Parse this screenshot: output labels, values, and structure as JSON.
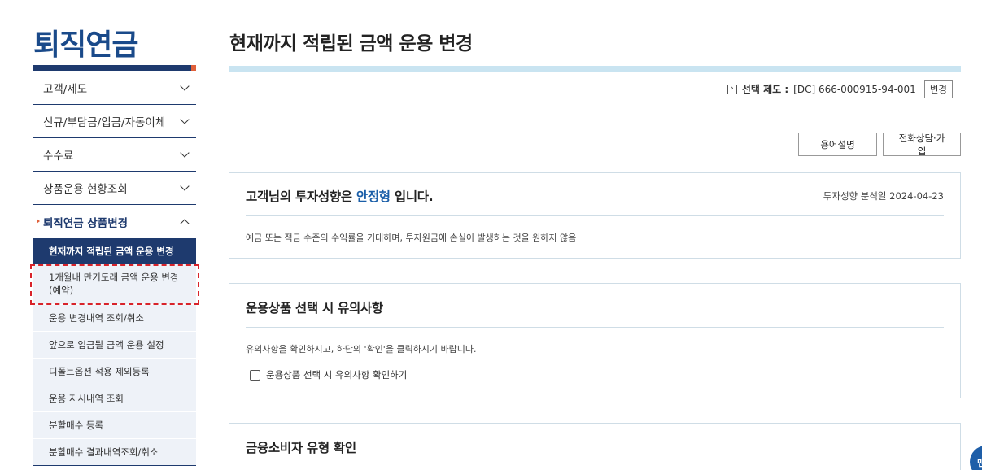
{
  "brand": "퇴직연금",
  "sidebar": {
    "items": [
      {
        "label": "고객/제도"
      },
      {
        "label": "신규/부담금/입금/자동이체"
      },
      {
        "label": "수수료"
      },
      {
        "label": "상품운용 현황조회"
      },
      {
        "label": "퇴직연금 상품변경"
      }
    ],
    "submenu": {
      "active": "현재까지 적립된 금액 운용 변경",
      "items": [
        {
          "label": "1개월내 만기도래 금액 운용 변경(예약)"
        },
        {
          "label": "운용 변경내역 조회/취소"
        },
        {
          "label": "앞으로 입금될 금액 운용 설정"
        },
        {
          "label": "디폴트옵션 적용 제외등록"
        },
        {
          "label": "운용 지시내역 조회"
        },
        {
          "label": "분할매수 등록"
        },
        {
          "label": "분할매수 결과내역조회/취소"
        }
      ]
    }
  },
  "main": {
    "title": "현재까지 적립된 금액 운용 변경",
    "selection": {
      "arrow": "›",
      "label": "선택 제도 :",
      "value": "[DC] 666-000915-94-001",
      "change_button": "변경"
    },
    "buttons": {
      "glossary": "용어설명",
      "consult": "전화상담·가입"
    },
    "profile_panel": {
      "title_prefix": "고객님의 투자성향은",
      "title_type": "안정형",
      "title_suffix": "입니다.",
      "date": "투자성향 분석일 2024-04-23",
      "description": "예금 또는 적금 수준의 수익률을 기대하며, 투자원금에 손실이 발생하는 것을 원하지 않음"
    },
    "notice_panel": {
      "title": "운용상품 선택 시 유의사항",
      "description": "유의사항을 확인하시고, 하단의 '확인'을 클릭하시기 바랍니다.",
      "checkbox_label": "운용상품 선택 시 유의사항 확인하기"
    },
    "consumer_panel": {
      "title": "금융소비자 유형 확인"
    },
    "floating_button": "맨"
  }
}
